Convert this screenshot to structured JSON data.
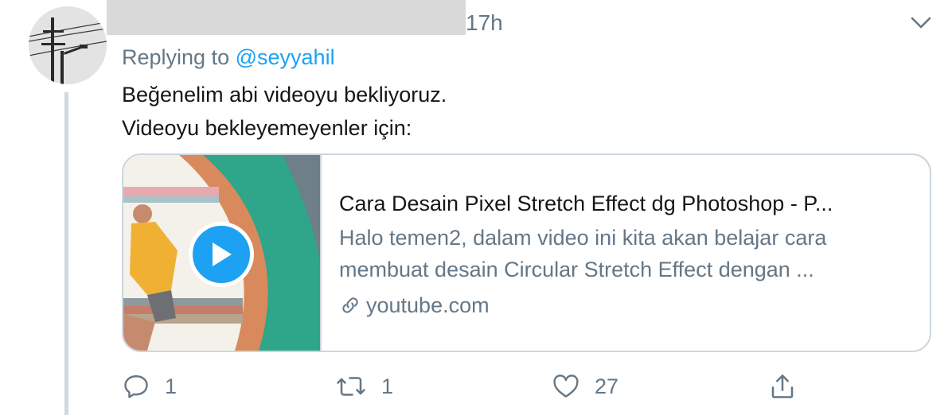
{
  "header": {
    "time": "17h"
  },
  "replying": {
    "prefix": "Replying to",
    "handle": "@seyyahil"
  },
  "tweet": {
    "line1": "Beğenelim abi videoyu bekliyoruz.",
    "line2": "Videoyu bekleyemeyenler için:"
  },
  "card": {
    "title": "Cara Desain Pixel Stretch Effect dg Photoshop - P...",
    "desc_line1": "Halo temen2, dalam video ini kita akan belajar cara",
    "desc_line2": "membuat desain Circular Stretch Effect dengan ...",
    "domain": "youtube.com"
  },
  "actions": {
    "reply_count": "1",
    "retweet_count": "1",
    "like_count": "27"
  },
  "icons": {
    "avatar": "power-pole-avatar",
    "chevron": "chevron-down-icon",
    "play": "play-icon",
    "link": "link-icon",
    "reply": "reply-icon",
    "retweet": "retweet-icon",
    "like": "heart-icon",
    "share": "share-icon"
  },
  "colors": {
    "accent": "#1da1f2",
    "secondary_text": "#657786",
    "border": "#ccd6dd"
  }
}
